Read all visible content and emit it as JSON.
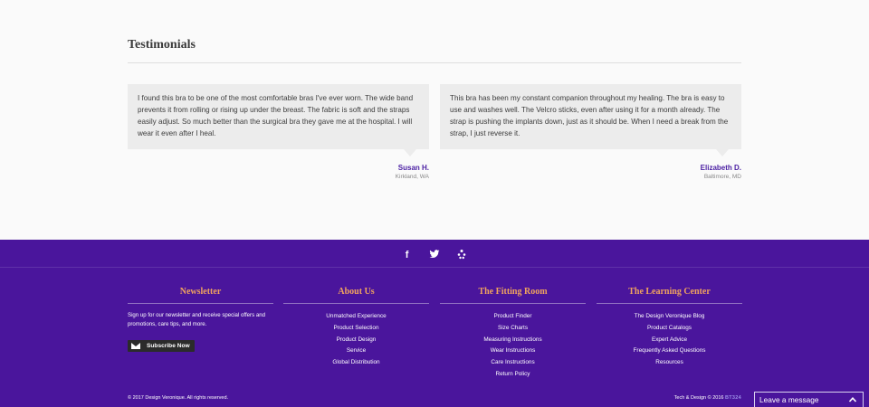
{
  "testimonials": {
    "title": "Testimonials",
    "items": [
      {
        "text": "I found this bra to be one of the most comfortable bras I've ever worn.  The wide band prevents it from rolling or rising up under the breast.  The fabric is soft and the straps easily adjust.   So much better than the surgical bra they gave me at the hospital.  I will wear it even after I heal.",
        "name": "Susan H.",
        "location": "Kirkland, WA"
      },
      {
        "text": "This bra has been my constant companion throughout my healing.  The bra is easy to use and washes well.  The Velcro sticks, even after using it for a month already.  The strap is pushing the implants down, just as it should be.  When I need a break from the strap, I just reverse it.",
        "name": "Elizabeth D.",
        "location": "Baltimore, MD"
      }
    ]
  },
  "footer": {
    "social": [
      "facebook-icon",
      "twitter-icon",
      "yelp-icon"
    ],
    "newsletter": {
      "heading": "Newsletter",
      "text": "Sign up for our newsletter and receive special offers and promotions, care tips, and more.",
      "button": "Subscribe Now"
    },
    "about": {
      "heading": "About Us",
      "links": [
        "Unmatched Experience",
        "Product Selection",
        "Product Design",
        "Service",
        "Global Distribution"
      ]
    },
    "fitting": {
      "heading": "The Fitting Room",
      "links": [
        "Product Finder",
        "Size Charts",
        "Measuring Instructions",
        "Wear Instructions",
        "Care Instructions",
        "Return Policy"
      ]
    },
    "learning": {
      "heading": "The Learning Center",
      "links": [
        "The Design Veronique Blog",
        "Product Catalogs",
        "Expert Advice",
        "Frequently Asked Questions",
        "Resources"
      ]
    },
    "copyright": "© 2017 Design Veronique.  All rights reserved.",
    "credit_prefix": "Tech & Design © 2016",
    "credit_brand": "BT324"
  },
  "chat": {
    "label": "Leave a message"
  },
  "colors": {
    "footer_bg": "#4a159c",
    "heading_accent": "#f0a35e",
    "name_accent": "#4b1fa3"
  }
}
